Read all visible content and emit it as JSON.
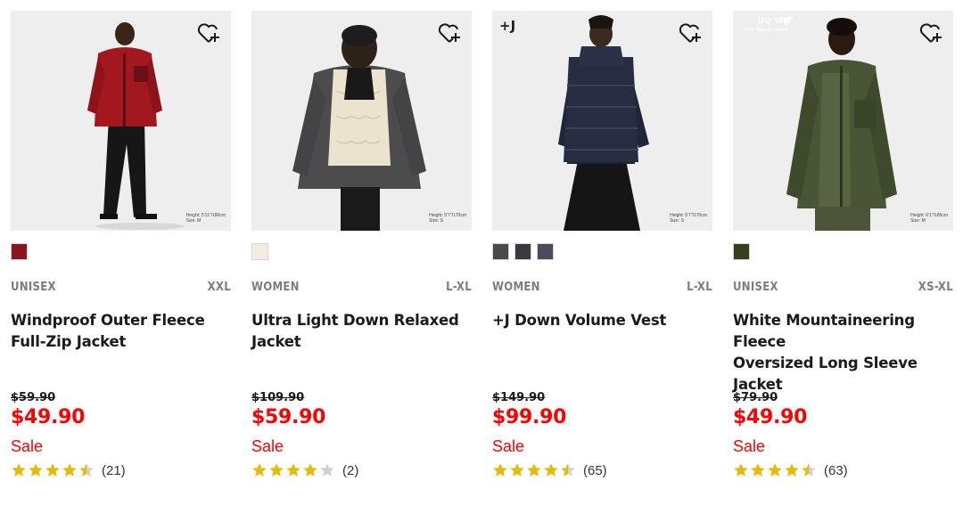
{
  "colors": {
    "sale_red": "#ff0000",
    "star_gold": "#e7b909",
    "star_empty": "#d0d0d0"
  },
  "products": [
    {
      "gender": "UNISEX",
      "sizes": "XXL",
      "name_line1": "Windproof Outer Fleece",
      "name_line2": "Full-Zip Jacket",
      "original_price": "$59.90",
      "price": "$49.90",
      "sale_label": "Sale",
      "rating": 4.5,
      "review_count": "(21)",
      "model_height": "Height: 5'11\"/180cm",
      "model_size": "Size: M",
      "swatches": [
        "#8c1620"
      ],
      "wishlist_icon": "heart-plus-icon"
    },
    {
      "gender": "WOMEN",
      "sizes": "L-XL",
      "name_line1": "Ultra Light Down Relaxed",
      "name_line2": "Jacket",
      "original_price": "$109.90",
      "price": "$59.90",
      "sale_label": "Sale",
      "rating": 4,
      "review_count": "(2)",
      "model_height": "Height: 5'7\"/170cm",
      "model_size": "Size: S",
      "swatches": [
        "#f4ecdf"
      ],
      "wishlist_icon": "heart-plus-icon"
    },
    {
      "gender": "WOMEN",
      "sizes": "L-XL",
      "name_line1": "+J Down Volume Vest",
      "name_line2": "",
      "original_price": "$149.90",
      "price": "$99.90",
      "sale_label": "Sale",
      "rating": 4.5,
      "review_count": "(65)",
      "model_height": "Height: 5'7\"/170cm",
      "model_size": "Size: S",
      "badge": "+J",
      "swatches": [
        "#4a4a4c",
        "#3a3b3e",
        "#4a4d5e"
      ],
      "wishlist_icon": "heart-plus-icon"
    },
    {
      "gender": "UNISEX",
      "sizes": "XS-XL",
      "name_line1": "White Mountaineering Fleece",
      "name_line2": "Oversized Long Sleeve Jacket",
      "original_price": "$79.90",
      "price": "$49.90",
      "sale_label": "Sale",
      "rating": 4.5,
      "review_count": "(63)",
      "model_height": "Height: 6'1\"/185cm",
      "model_size": "Size: M",
      "badge_logo": "UQ WM",
      "badge_text": "White Mountaineering",
      "swatches": [
        "#36401f"
      ],
      "wishlist_icon": "heart-plus-icon"
    }
  ]
}
